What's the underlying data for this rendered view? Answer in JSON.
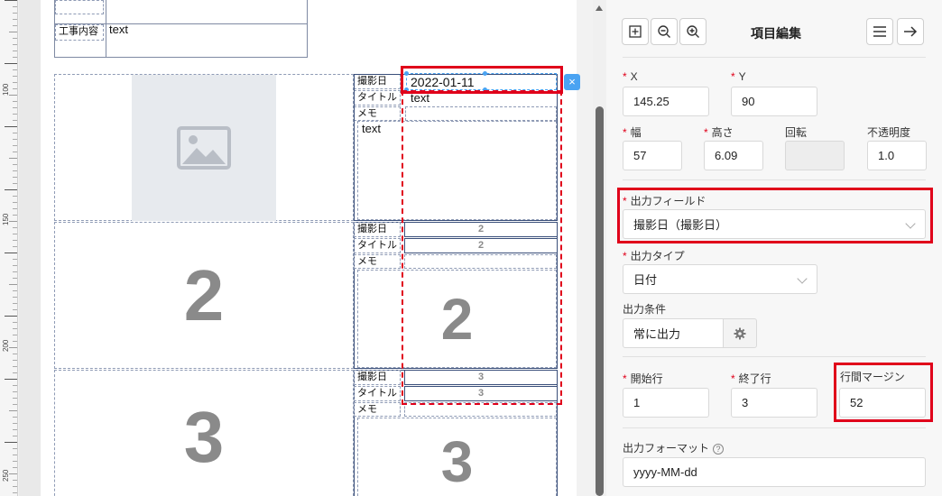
{
  "canvas": {
    "ruler_labels": [
      "100",
      "150",
      "200",
      "250"
    ],
    "top_block": {
      "label": "工事内容",
      "value": "text"
    },
    "rows": [
      {
        "labels": [
          "撮影日",
          "タイトル",
          "メモ"
        ],
        "date_value": "2022-01-11",
        "title_value": "text",
        "memo_value": "text",
        "photo": "image-placeholder-icon"
      },
      {
        "labels": [
          "撮影日",
          "タイトル",
          "メモ"
        ],
        "date_value": "2",
        "title_value": "2",
        "memo_value": "2",
        "photo_number": "2"
      },
      {
        "labels": [
          "撮影日",
          "タイトル",
          "メモ"
        ],
        "date_value": "3",
        "title_value": "3",
        "memo_value": "3",
        "photo_number": "3"
      }
    ],
    "close_symbol": "×"
  },
  "panel": {
    "title": "項目編集",
    "toolbar_icons": [
      "fit-icon",
      "zoom-out-icon",
      "zoom-in-icon",
      "menu-icon",
      "arrow-right-icon"
    ],
    "x": {
      "label": "X",
      "value": "145.25"
    },
    "y": {
      "label": "Y",
      "value": "90"
    },
    "width": {
      "label": "幅",
      "value": "57"
    },
    "height": {
      "label": "高さ",
      "value": "6.09"
    },
    "rotation": {
      "label": "回転",
      "value": ""
    },
    "opacity": {
      "label": "不透明度",
      "value": "1.0"
    },
    "output_field": {
      "label": "出力フィールド",
      "value": "撮影日（撮影日）"
    },
    "output_type": {
      "label": "出力タイプ",
      "value": "日付"
    },
    "output_condition": {
      "label": "出力条件",
      "value": "常に出力"
    },
    "start_row": {
      "label": "開始行",
      "value": "1"
    },
    "end_row": {
      "label": "終了行",
      "value": "3"
    },
    "line_margin": {
      "label": "行間マージン",
      "value": "52"
    },
    "output_format": {
      "label": "出力フォーマット",
      "help": "?",
      "value": "yyyy-MM-dd"
    },
    "required_mark": "*"
  },
  "colors": {
    "highlight_red": "#e0001a",
    "selection_blue": "#4aa3f2",
    "placeholder_gray": "#8a8a8a"
  }
}
